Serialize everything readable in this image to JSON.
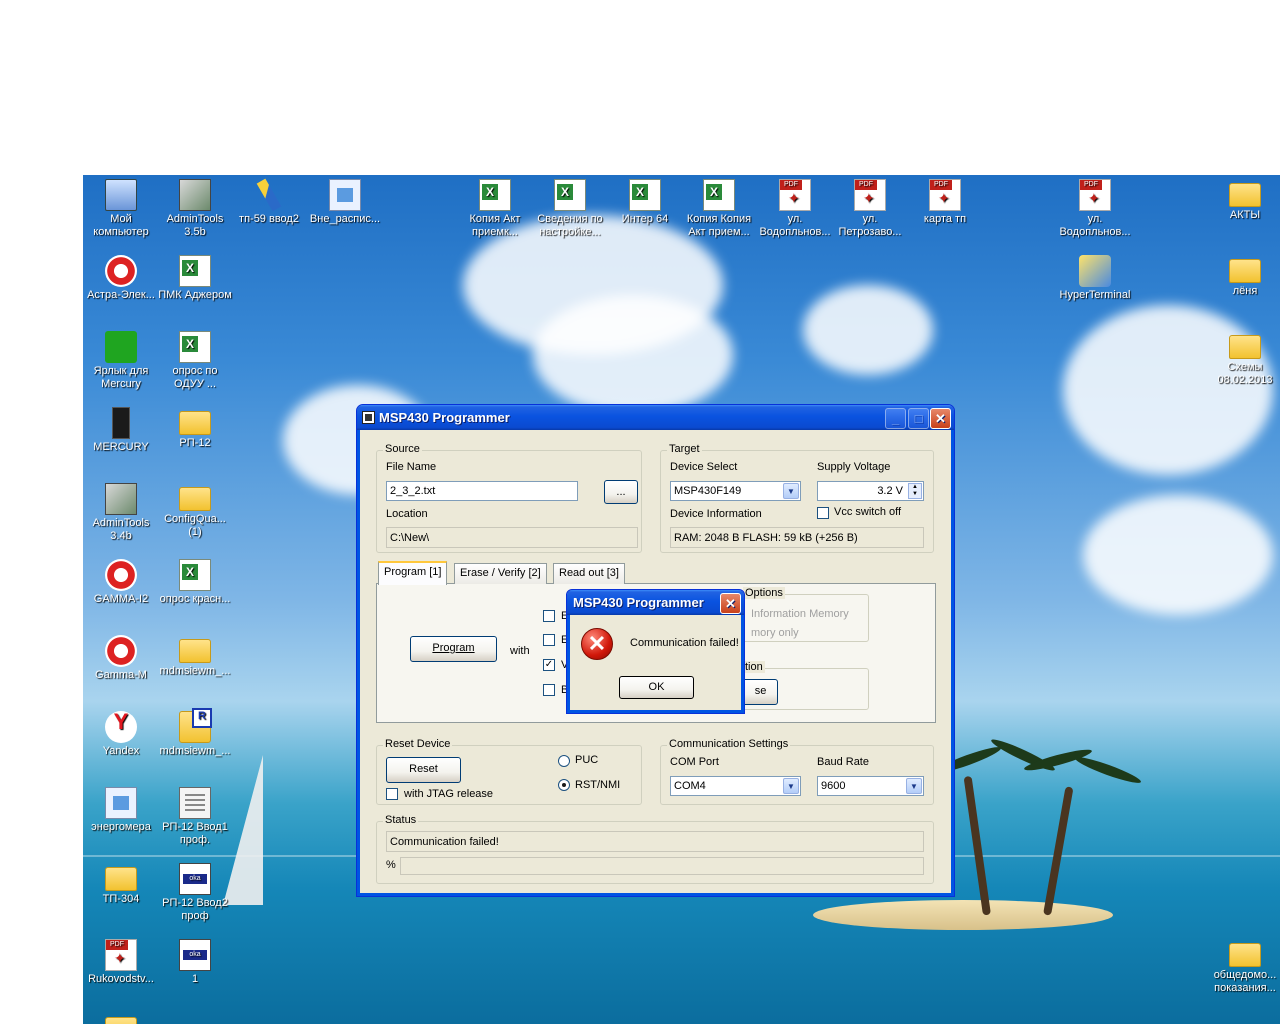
{
  "desktop": {
    "icons": [
      {
        "label": "Мой компьютер",
        "glyph": "my-computer-icon"
      },
      {
        "label": "AdminTools 3.5b",
        "glyph": "admintools-icon"
      },
      {
        "label": "тп-59 ввод2",
        "glyph": "pen-icon"
      },
      {
        "label": "Вне_распис...",
        "glyph": "document-icon"
      },
      {
        "label": "Копия Акт приемк...",
        "glyph": "excel-icon"
      },
      {
        "label": "Сведения по настройке...",
        "glyph": "excel-icon"
      },
      {
        "label": "Интер 64",
        "glyph": "excel-icon"
      },
      {
        "label": "Копия Копия Акт прием...",
        "glyph": "excel-icon"
      },
      {
        "label": "ул. Водопльнов...",
        "glyph": "pdf-icon"
      },
      {
        "label": "ул. Петрозаво...",
        "glyph": "pdf-icon"
      },
      {
        "label": "карта тп",
        "glyph": "pdf-icon"
      },
      {
        "label": "ул. Водопльнов...",
        "glyph": "pdf-icon"
      },
      {
        "label": "АКТЫ",
        "glyph": "folder-icon"
      },
      {
        "label": "Астра-Элек...",
        "glyph": "astra-icon"
      },
      {
        "label": "ПМК Аджером",
        "glyph": "excel-icon"
      },
      {
        "label": "HyperTerminal",
        "glyph": "hyperterminal-icon"
      },
      {
        "label": "лёня",
        "glyph": "folder-icon"
      },
      {
        "label": "Ярлык для Mercury",
        "glyph": "mercury-shortcut-icon"
      },
      {
        "label": "опрос по ОДУУ ...",
        "glyph": "excel-icon"
      },
      {
        "label": "Схемы 08.02.2013",
        "glyph": "folder-icon"
      },
      {
        "label": "MERCURY",
        "glyph": "mercury-icon"
      },
      {
        "label": "РП-12",
        "glyph": "folder-icon"
      },
      {
        "label": "AdminTools 3.4b",
        "glyph": "admintools-icon"
      },
      {
        "label": "ConfigQua... (1)",
        "glyph": "folder-icon"
      },
      {
        "label": "GAMMA-I2",
        "glyph": "gamma-icon"
      },
      {
        "label": "опрос красн...",
        "glyph": "excel-icon"
      },
      {
        "label": "Gamma-M",
        "glyph": "gamma-icon"
      },
      {
        "label": "mdmsiewm_...",
        "glyph": "folder-icon"
      },
      {
        "label": "Yandex",
        "glyph": "yandex-icon"
      },
      {
        "label": "mdmsiewm_...",
        "glyph": "rar-folder-icon"
      },
      {
        "label": "энергомера",
        "glyph": "document-icon"
      },
      {
        "label": "РП-12 Ввод1 проф.",
        "glyph": "notepad-icon"
      },
      {
        "label": "ТП-304",
        "glyph": "folder-icon"
      },
      {
        "label": "РП-12 Ввод2 проф",
        "glyph": "vfile-icon"
      },
      {
        "label": "Rukovodstv...",
        "glyph": "pdf-icon"
      },
      {
        "label": "1",
        "glyph": "vfile-icon"
      },
      {
        "label": "общедомо... показания...",
        "glyph": "folder-icon"
      }
    ]
  },
  "window": {
    "title": "MSP430 Programmer",
    "source": {
      "group": "Source",
      "file_name_label": "File Name",
      "file_name_value": "2_3_2.txt",
      "browse_label": "...",
      "location_label": "Location",
      "location_value": "C:\\New\\"
    },
    "target": {
      "group": "Target",
      "device_select_label": "Device Select",
      "device_value": "MSP430F149",
      "supply_voltage_label": "Supply Voltage",
      "supply_voltage_value": "3.2 V",
      "vcc_switch_off_label": "Vcc switch off",
      "device_info_label": "Device Information",
      "device_info_value": "RAM: 2048 B  FLASH: 59 kB  (+256 B)"
    },
    "tabs": [
      "Program   [1]",
      "Erase / Verify   [2]",
      "Read out   [3]"
    ],
    "program_panel": {
      "program_button": "Program",
      "with_label": "with",
      "check_e1": "E",
      "check_e2": "E",
      "check_v": "V",
      "check_b": "B",
      "options_group": "Options",
      "info_memory_label": "Information Memory",
      "memory_only_label": "mory only",
      "verification_group": "tion",
      "verify_button_tail": "se"
    },
    "reset": {
      "group": "Reset Device",
      "reset_button": "Reset",
      "jtag_label": "with JTAG release",
      "puc_label": "PUC",
      "rst_label": "RST/NMI"
    },
    "comm": {
      "group": "Communication Settings",
      "com_port_label": "COM Port",
      "com_port_value": "COM4",
      "baud_rate_label": "Baud Rate",
      "baud_rate_value": "9600"
    },
    "status": {
      "group": "Status",
      "message": "Communication failed!",
      "percent_label": "%"
    }
  },
  "dialog": {
    "title": "MSP430 Programmer",
    "message": "Communication failed!",
    "ok_label": "OK"
  }
}
